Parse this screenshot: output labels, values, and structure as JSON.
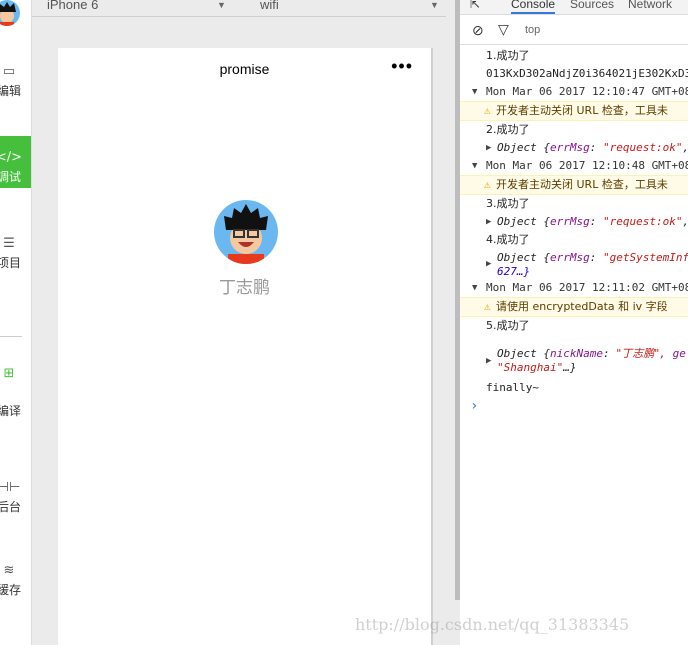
{
  "sidebar": {
    "items": [
      {
        "label": "编辑",
        "icon": "code-box-icon"
      },
      {
        "label": "调试",
        "icon": "code-icon",
        "active": true
      },
      {
        "label": "项目",
        "icon": "menu-icon"
      },
      {
        "label": "编译",
        "icon": "compile-icon"
      },
      {
        "label": "后台",
        "icon": "backend-icon"
      },
      {
        "label": "缓存",
        "icon": "layers-icon"
      }
    ]
  },
  "topbar": {
    "device": "iPhone 6",
    "network": "wifi"
  },
  "phone": {
    "title": "promise",
    "more": "•••",
    "nickname": "丁志鹏"
  },
  "devtools": {
    "tabs": [
      "Console",
      "Sources",
      "Network"
    ],
    "filter": "top",
    "lines": {
      "l1": "1.成功了",
      "code": "013KxD302aNdjZ0i364021jE302KxD3",
      "g1": "Mon Mar 06 2017 12:10:47 GMT+08",
      "w1": "开发者主动关闭 URL 检查，工具未",
      "l2": "2.成功了",
      "o2a": "Object {",
      "o2k": "errMsg",
      "o2v": "\"request:ok\"",
      "o2e": ",",
      "g2": "Mon Mar 06 2017 12:10:48 GMT+08",
      "w2": "开发者主动关闭 URL 检查，工具未",
      "l3": "3.成功了",
      "l4": "4.成功了",
      "o4v": "\"getSystemInf",
      "o4b": "627…}",
      "g3": "Mon Mar 06 2017 12:11:02 GMT+08",
      "w3": "请使用 encryptedData 和 iv 字段",
      "l5": "5.成功了",
      "o5k": "nickName",
      "o5v": "\"丁志鹏\"",
      "o5e": ", ge",
      "o5b": "\"Shanghai\"",
      "o5c": "…}",
      "fin": "finally~",
      "prompt": "›"
    }
  },
  "watermark": "http://blog.csdn.net/qq_31383345"
}
